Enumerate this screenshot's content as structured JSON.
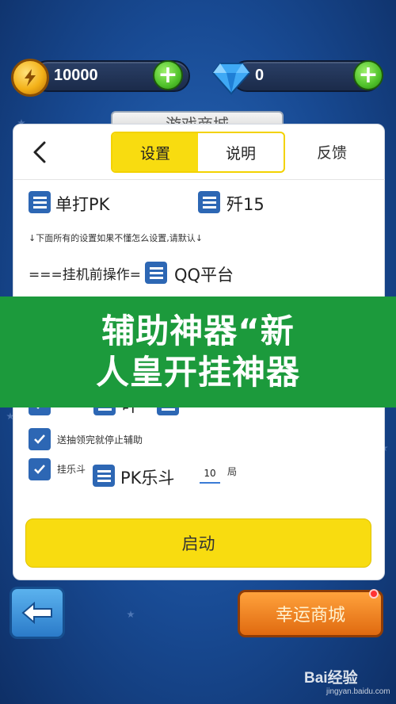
{
  "topbar": {
    "coins": "10000",
    "gems": "0",
    "add_symbol": "+"
  },
  "panel": {
    "title_tab": "游戏商城",
    "tabs": [
      "设置",
      "说明"
    ],
    "active_tab": "设置",
    "feedback": "反馈",
    "options_row1": [
      "单打PK",
      "歼15"
    ],
    "hint": "↓下面所有的设置如果不懂怎么设置,请默认↓",
    "pre_operation_label": "===挂机前操作=",
    "platform": "QQ平台",
    "partial_row": "叶",
    "checkbox_stop": "送抽领完就停止辅助",
    "checkbox_fun": "挂乐斗",
    "pk_mode": "PK乐斗",
    "rounds_value": "10",
    "rounds_unit": "局",
    "start_button": "启动"
  },
  "banner": {
    "line1": "辅助神器“新",
    "line2": "人皇开挂神器"
  },
  "bottom": {
    "shop_button": "幸运商城"
  },
  "watermark": {
    "logo": "Bai经验",
    "url": "jingyan.baidu.com"
  },
  "colors": {
    "accent_yellow": "#f8dc10",
    "icon_blue": "#2d67b4",
    "banner_green": "#1c9a3c"
  }
}
